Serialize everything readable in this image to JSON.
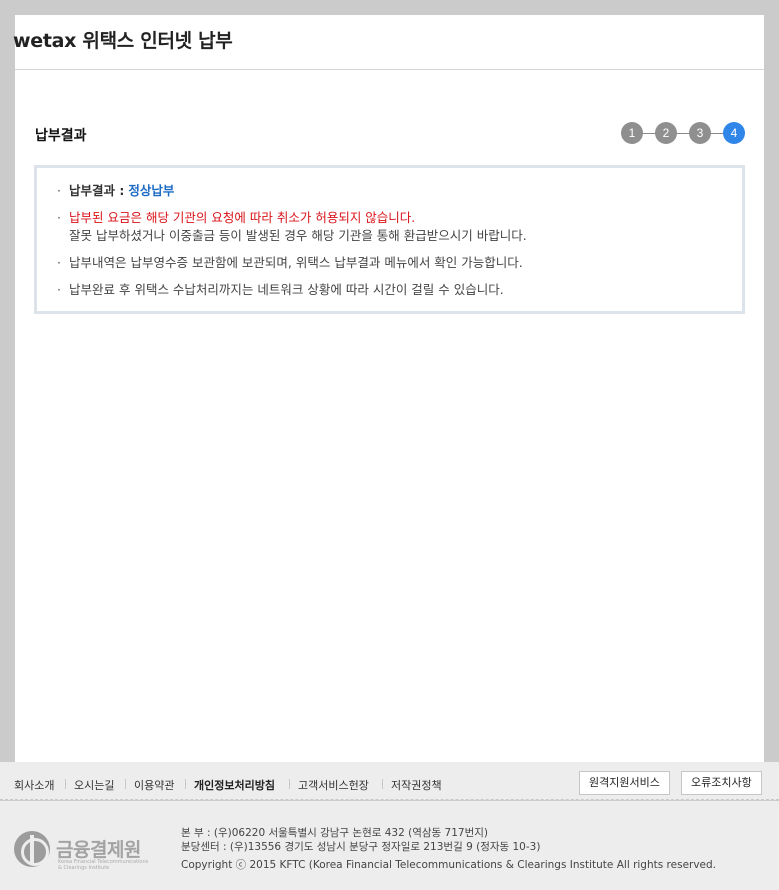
{
  "header": {
    "title": "wetax 위택스 인터넷 납부"
  },
  "section": {
    "title": "납부결과"
  },
  "steps": [
    "1",
    "2",
    "3",
    "4"
  ],
  "active_step": "4",
  "notices": {
    "result_label": "납부결과 :",
    "result_value": "정상납부",
    "warning_line": "납부된 요금은 해당 기관의 요청에 따라 취소가 허용되지 않습니다.",
    "refund_line": "잘못 납부하셨거나 이중출금 등이 발생된 경우 해당 기관을 통해 환급받으시기 바랍니다.",
    "receipt_line": "납부내역은 납부영수증 보관함에 보관되며, 위택스 납부결과 메뉴에서 확인 가능합니다.",
    "delay_line": "납부완료 후 위택스 수납처리까지는 네트워크 상황에 따라 시간이 걸릴 수 있습니다."
  },
  "footer": {
    "links": [
      "회사소개",
      "오시는길",
      "이용약관",
      "개인정보처리방침",
      "고객서비스헌장",
      "저작권정책"
    ],
    "buttons": {
      "remote": "원격지원서비스",
      "error": "오류조치사항"
    },
    "logo_text": "금융결제원",
    "logo_sub1": "Korea Financial Telecommunications",
    "logo_sub2": "& Clearings Institute",
    "address_main": "본 부 : (우)06220 서울특별시 강남구 논현로 432 (역삼동 717번지)",
    "address_branch": "분당센터 : (우)13556 경기도 성남시 분당구 정자일로 213번길 9 (정자동 10-3)",
    "copyright": "Copyright ⓒ 2015 KFTC (Korea Financial Telecommunications & Clearings Institute All rights reserved."
  },
  "colors": {
    "accent": "#2f86e8",
    "status_blue": "#1c6bc4",
    "warning_red": "#d9141a",
    "step_gray": "#8f8f8f"
  }
}
